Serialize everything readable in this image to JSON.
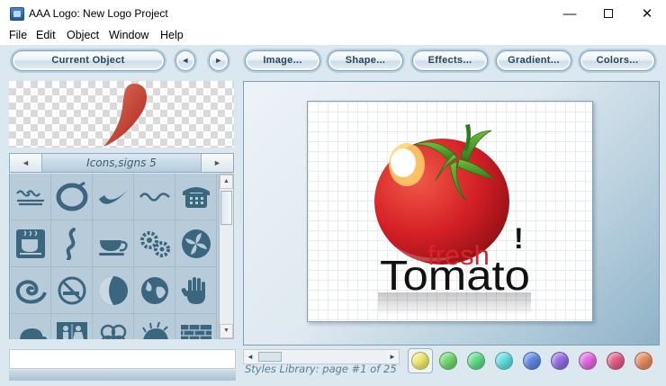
{
  "window": {
    "title": "AAA Logo: New Logo Project",
    "min_glyph": "—",
    "close_glyph": "✕"
  },
  "menu": {
    "items": [
      "File",
      "Edit",
      "Object",
      "Window",
      "Help"
    ]
  },
  "toolbar": {
    "current_object": "Current Object",
    "prev_glyph": "◄",
    "next_glyph": "►",
    "image": "Image...",
    "shape": "Shape...",
    "effects": "Effects...",
    "gradient": "Gradient...",
    "colors": "Colors..."
  },
  "library": {
    "title": "Icons,signs 5",
    "prev_glyph": "◄",
    "next_glyph": "►",
    "icons": [
      "waves-icon",
      "ring-swirl-icon",
      "swoosh-icon",
      "wave-line-icon",
      "telephone-icon",
      "coffee-cup-icon",
      "s-curve-icon",
      "teacup-icon",
      "gears-icon",
      "propeller-icon",
      "spiral-wave-icon",
      "no-smoking-icon",
      "half-moon-icon",
      "globe-icon",
      "hand-print-icon",
      "turtle-icon",
      "restroom-icon",
      "clover-icon",
      "hedgehog-icon",
      "brick-wall-icon"
    ]
  },
  "canvas": {
    "logo_word_small": "fresh",
    "logo_word_large": "Tomato",
    "logo_exclaim": "!"
  },
  "styles": {
    "label": "Styles Library: page #1 of 25",
    "current_page": 1,
    "total_pages": 25
  },
  "swatches": [
    "#ece86a",
    "#6fd46a",
    "#5ed985",
    "#5fdcdc",
    "#5a86e0",
    "#8f6ae0",
    "#e065e0",
    "#e05a86",
    "#e38a5a"
  ],
  "colors": {
    "accent": "#cddde8",
    "panel": "#b8cbd8",
    "tomato": "#d7242c",
    "leaf": "#3f8a24"
  }
}
